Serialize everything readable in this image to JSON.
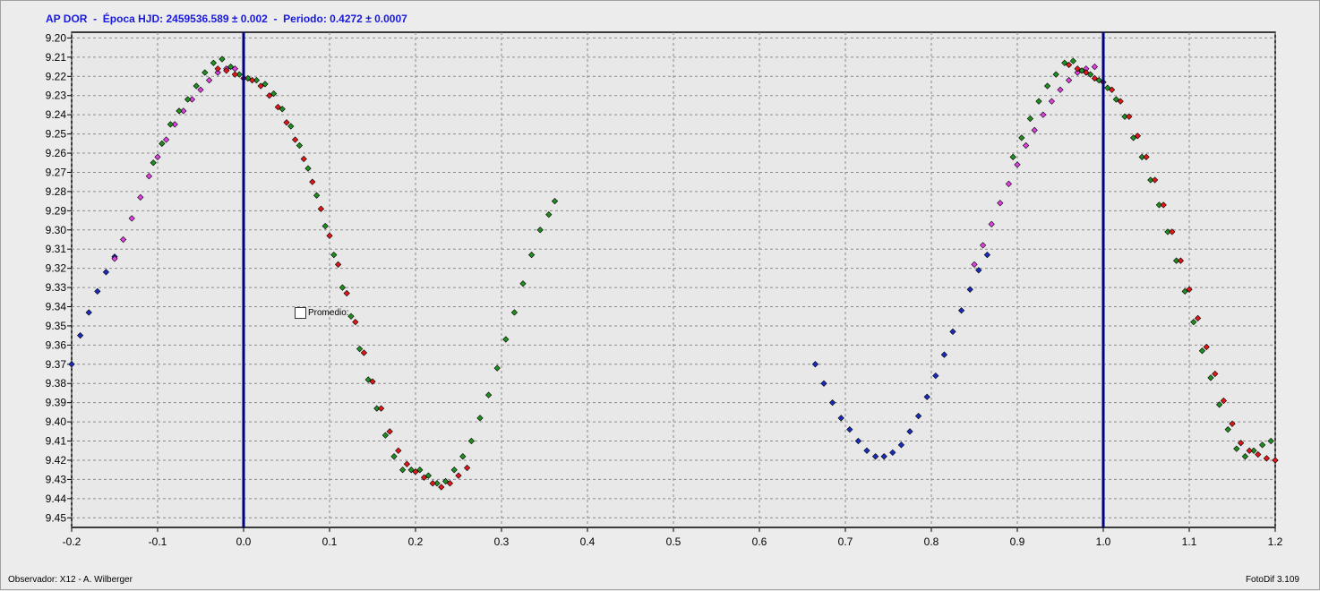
{
  "window": {
    "title": "AP DOR  -  Época HJD: 2459536.589 ± 0.002  -  Periodo: 0.4272 ± 0.0007",
    "observer": "Observador: X12 - A. Wilberger",
    "software": "FotoDif 3.109",
    "legend_label": "Promedio:"
  },
  "colors": {
    "background": "#ececec",
    "plot_bg": "#e8e8e8",
    "title": "#1a1adc",
    "grid": "#8a8a8a",
    "axis": "#000000",
    "vline": "#000080",
    "series_green": "#1f8f1f",
    "series_red": "#e01818",
    "series_magenta": "#e040e0",
    "series_blue": "#1a2cc0"
  },
  "chart_data": {
    "type": "scatter",
    "title": "AP DOR  -  Época HJD: 2459536.589 ± 0.002  -  Periodo: 0.4272 ± 0.0007",
    "xlabel": "",
    "ylabel": "",
    "xlim": [
      -0.2,
      1.2
    ],
    "ylim": [
      9.455,
      9.197
    ],
    "y_inverted": true,
    "grid": true,
    "x_ticks": [
      "-0.2",
      "-0.1",
      "0.0",
      "0.1",
      "0.2",
      "0.3",
      "0.4",
      "0.5",
      "0.6",
      "0.7",
      "0.8",
      "0.9",
      "1.0",
      "1.1",
      "1.2"
    ],
    "y_ticks": [
      "9.20",
      "9.21",
      "9.22",
      "9.23",
      "9.24",
      "9.25",
      "9.26",
      "9.27",
      "9.28",
      "9.29",
      "9.30",
      "9.31",
      "9.32",
      "9.33",
      "9.34",
      "9.35",
      "9.36",
      "9.37",
      "9.38",
      "9.39",
      "9.40",
      "9.41",
      "9.42",
      "9.43",
      "9.44",
      "9.45"
    ],
    "vertical_lines": [
      0.0,
      1.0
    ],
    "series": [
      {
        "color": "green",
        "x": [
          -0.105,
          -0.095,
          -0.085,
          -0.075,
          -0.065,
          -0.055,
          -0.045,
          -0.035,
          -0.025,
          -0.015,
          -0.005,
          0.005,
          0.015,
          0.025,
          0.035,
          0.045,
          0.055,
          0.065,
          0.075,
          0.085,
          0.095,
          0.105,
          0.115,
          0.125,
          0.135,
          0.145,
          0.155,
          0.165,
          0.175,
          0.185,
          0.195,
          0.205,
          0.215,
          0.225,
          0.235,
          0.245,
          0.255,
          0.265,
          0.275,
          0.285,
          0.295,
          0.305,
          0.315,
          0.325,
          0.335,
          0.345,
          0.355,
          0.362,
          0.895,
          0.905,
          0.915,
          0.925,
          0.935,
          0.945,
          0.955,
          0.965,
          0.975,
          0.985,
          0.995,
          1.005,
          1.015,
          1.025,
          1.035,
          1.045,
          1.055,
          1.065,
          1.075,
          1.085,
          1.095,
          1.105,
          1.115,
          1.125,
          1.135,
          1.145,
          1.155,
          1.165,
          1.175,
          1.185,
          1.195
        ],
        "y": [
          9.265,
          9.255,
          9.245,
          9.238,
          9.232,
          9.225,
          9.218,
          9.213,
          9.211,
          9.215,
          9.219,
          9.221,
          9.222,
          9.224,
          9.229,
          9.237,
          9.246,
          9.256,
          9.268,
          9.282,
          9.298,
          9.313,
          9.33,
          9.345,
          9.362,
          9.378,
          9.393,
          9.407,
          9.418,
          9.425,
          9.425,
          9.425,
          9.428,
          9.432,
          9.431,
          9.425,
          9.418,
          9.41,
          9.398,
          9.386,
          9.372,
          9.357,
          9.343,
          9.328,
          9.313,
          9.3,
          9.292,
          9.285,
          9.262,
          9.252,
          9.242,
          9.233,
          9.225,
          9.219,
          9.213,
          9.212,
          9.217,
          9.219,
          9.222,
          9.226,
          9.232,
          9.241,
          9.252,
          9.262,
          9.274,
          9.287,
          9.301,
          9.316,
          9.332,
          9.348,
          9.363,
          9.377,
          9.391,
          9.404,
          9.414,
          9.418,
          9.415,
          9.412,
          9.41
        ]
      },
      {
        "color": "red",
        "x": [
          -0.03,
          -0.02,
          -0.01,
          0.0,
          0.01,
          0.02,
          0.03,
          0.04,
          0.05,
          0.06,
          0.07,
          0.08,
          0.09,
          0.1,
          0.11,
          0.12,
          0.13,
          0.14,
          0.15,
          0.16,
          0.17,
          0.18,
          0.19,
          0.2,
          0.21,
          0.22,
          0.23,
          0.24,
          0.25,
          0.26,
          0.96,
          0.97,
          0.98,
          0.99,
          1.0,
          1.01,
          1.02,
          1.03,
          1.04,
          1.05,
          1.06,
          1.07,
          1.08,
          1.09,
          1.1,
          1.11,
          1.12,
          1.13,
          1.14,
          1.15,
          1.16,
          1.17,
          1.18,
          1.19,
          1.2
        ],
        "y": [
          9.216,
          9.217,
          9.219,
          9.221,
          9.222,
          9.225,
          9.23,
          9.236,
          9.244,
          9.253,
          9.263,
          9.275,
          9.289,
          9.303,
          9.318,
          9.333,
          9.348,
          9.364,
          9.379,
          9.393,
          9.405,
          9.415,
          9.422,
          9.426,
          9.429,
          9.432,
          9.434,
          9.432,
          9.428,
          9.424,
          9.214,
          9.216,
          9.218,
          9.221,
          9.223,
          9.227,
          9.233,
          9.241,
          9.251,
          9.262,
          9.274,
          9.287,
          9.301,
          9.316,
          9.331,
          9.346,
          9.361,
          9.375,
          9.389,
          9.401,
          9.411,
          9.415,
          9.417,
          9.419,
          9.42
        ]
      },
      {
        "color": "magenta",
        "x": [
          -0.15,
          -0.14,
          -0.13,
          -0.12,
          -0.11,
          -0.1,
          -0.09,
          -0.08,
          -0.07,
          -0.06,
          -0.05,
          -0.04,
          -0.03,
          -0.02,
          -0.01,
          0.85,
          0.86,
          0.87,
          0.88,
          0.89,
          0.9,
          0.91,
          0.92,
          0.93,
          0.94,
          0.95,
          0.96,
          0.97,
          0.98,
          0.99
        ],
        "y": [
          9.315,
          9.305,
          9.294,
          9.283,
          9.272,
          9.262,
          9.253,
          9.245,
          9.238,
          9.232,
          9.227,
          9.222,
          9.218,
          9.216,
          9.216,
          9.318,
          9.308,
          9.297,
          9.286,
          9.276,
          9.266,
          9.256,
          9.248,
          9.24,
          9.233,
          9.227,
          9.222,
          9.218,
          9.216,
          9.215
        ]
      },
      {
        "color": "blue",
        "x": [
          -0.2,
          -0.19,
          -0.18,
          -0.17,
          -0.16,
          -0.15,
          0.665,
          0.675,
          0.685,
          0.695,
          0.705,
          0.715,
          0.725,
          0.735,
          0.745,
          0.755,
          0.765,
          0.775,
          0.785,
          0.795,
          0.805,
          0.815,
          0.825,
          0.835,
          0.845,
          0.855,
          0.865
        ],
        "y": [
          9.37,
          9.355,
          9.343,
          9.332,
          9.322,
          9.314,
          9.37,
          9.38,
          9.39,
          9.398,
          9.404,
          9.41,
          9.415,
          9.418,
          9.418,
          9.416,
          9.412,
          9.405,
          9.397,
          9.387,
          9.376,
          9.365,
          9.353,
          9.342,
          9.331,
          9.321,
          9.313
        ]
      }
    ]
  }
}
